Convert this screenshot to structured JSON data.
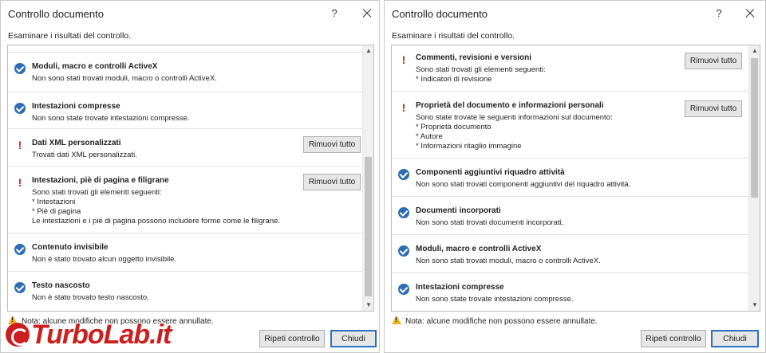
{
  "left": {
    "title": "Controllo documento",
    "help": "?",
    "subtitle": "Esaminare i risultati del controllo.",
    "rows": [
      {
        "title": "Moduli, macro e controlli ActiveX",
        "lines": [
          "Non sono stati trovati moduli, macro o controlli ActiveX."
        ],
        "status": "ok"
      },
      {
        "title": "Intestazioni compresse",
        "lines": [
          "Non sono state trovate intestazioni compresse."
        ],
        "status": "ok"
      },
      {
        "title": "Dati XML personalizzati",
        "lines": [
          "Trovati dati XML personalizzati."
        ],
        "status": "warning",
        "button": "Rimuovi tutto"
      },
      {
        "title": "Intestazioni, piè di pagina e filigrane",
        "lines": [
          "Sono stati trovati gli elementi seguenti:",
          "* Intestazioni",
          "* Piè di pagina",
          "Le intestazioni e i piè di pagina possono includere forme come le filigrane."
        ],
        "status": "warning",
        "button": "Rimuovi tutto"
      },
      {
        "title": "Contenuto invisibile",
        "lines": [
          "Non è stato trovato alcun oggetto invisibile."
        ],
        "status": "ok"
      },
      {
        "title": "Testo nascosto",
        "lines": [
          "Non è stato trovato testo nascosto."
        ],
        "status": "ok"
      }
    ],
    "note": "Nota: alcune modifiche non possono essere annullate.",
    "recheck": "Ripeti controllo",
    "close": "Chiudi",
    "watermark": "TurboLab.it"
  },
  "right": {
    "title": "Controllo documento",
    "help": "?",
    "subtitle": "Esaminare i risultati del controllo.",
    "rows": [
      {
        "title": "Commenti, revisioni e versioni",
        "lines": [
          "Sono stati trovati gli elementi seguenti:",
          "* Indicatori di revisione"
        ],
        "status": "warning",
        "button": "Rimuovi tutto"
      },
      {
        "title": "Proprietà del documento e informazioni personali",
        "lines": [
          "Sono state trovate le seguenti informazioni sul documento:",
          "* Proprietà documento",
          "* Autore",
          "* Informazioni ritaglio immagine"
        ],
        "status": "warning",
        "button": "Rimuovi tutto"
      },
      {
        "title": "Componenti aggiuntivi riquadro attività",
        "lines": [
          "Non sono stati trovati componenti aggiuntivi del riquadro attività."
        ],
        "status": "ok"
      },
      {
        "title": "Documenti incorporati",
        "lines": [
          "Non sono stati trovati documenti incorporati."
        ],
        "status": "ok"
      },
      {
        "title": "Moduli, macro e controlli ActiveX",
        "lines": [
          "Non sono stati trovati moduli, macro o controlli ActiveX."
        ],
        "status": "ok"
      },
      {
        "title": "Intestazioni compresse",
        "lines": [
          "Non sono state trovate intestazioni compresse."
        ],
        "status": "ok"
      }
    ],
    "note": "Nota: alcune modifiche non possono essere annullate.",
    "recheck": "Ripeti controllo",
    "close": "Chiudi"
  }
}
